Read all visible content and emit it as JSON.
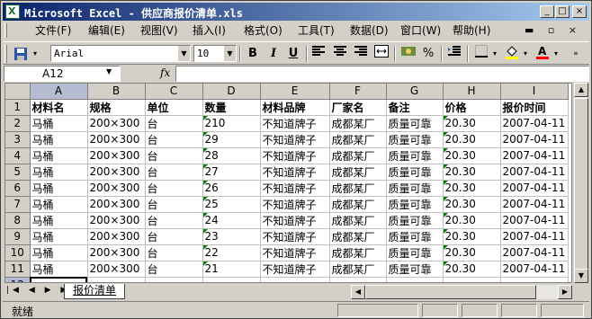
{
  "window": {
    "title": "Microsoft Excel - 供应商报价清单.xls"
  },
  "caption_buttons": [
    "_",
    "□",
    "×"
  ],
  "menu": [
    "文件(F)",
    "编辑(E)",
    "视图(V)",
    "插入(I)",
    "格式(O)",
    "工具(T)",
    "数据(D)",
    "窗口(W)",
    "帮助(H)"
  ],
  "toolbar": {
    "font_name": "Arial",
    "font_size": "10",
    "bold": "B",
    "italic": "I",
    "underline": "U",
    "percent": "%"
  },
  "formula_bar": {
    "cell_ref": "A12",
    "fx": "fx",
    "formula": ""
  },
  "grid": {
    "columns": [
      "A",
      "B",
      "C",
      "D",
      "E",
      "F",
      "G",
      "H",
      "I"
    ],
    "row_numbers": [
      "1",
      "2",
      "3",
      "4",
      "5",
      "6",
      "7",
      "8",
      "9",
      "10",
      "11",
      "12"
    ],
    "rows": [
      [
        "材料名",
        "规格",
        "单位",
        "数量",
        "材料品牌",
        "厂家名",
        "备注",
        "价格",
        "报价时间"
      ],
      [
        "马桶",
        "200×300",
        "台",
        "210",
        "不知道牌子",
        "成都某厂",
        "质量可靠",
        "20.30",
        "2007-04-11"
      ],
      [
        "马桶",
        "200×300",
        "台",
        "29",
        "不知道牌子",
        "成都某厂",
        "质量可靠",
        "20.30",
        "2007-04-11"
      ],
      [
        "马桶",
        "200×300",
        "台",
        "28",
        "不知道牌子",
        "成都某厂",
        "质量可靠",
        "20.30",
        "2007-04-11"
      ],
      [
        "马桶",
        "200×300",
        "台",
        "27",
        "不知道牌子",
        "成都某厂",
        "质量可靠",
        "20.30",
        "2007-04-11"
      ],
      [
        "马桶",
        "200×300",
        "台",
        "26",
        "不知道牌子",
        "成都某厂",
        "质量可靠",
        "20.30",
        "2007-04-11"
      ],
      [
        "马桶",
        "200×300",
        "台",
        "25",
        "不知道牌子",
        "成都某厂",
        "质量可靠",
        "20.30",
        "2007-04-11"
      ],
      [
        "马桶",
        "200×300",
        "台",
        "24",
        "不知道牌子",
        "成都某厂",
        "质量可靠",
        "20.30",
        "2007-04-11"
      ],
      [
        "马桶",
        "200×300",
        "台",
        "23",
        "不知道牌子",
        "成都某厂",
        "质量可靠",
        "20.30",
        "2007-04-11"
      ],
      [
        "马桶",
        "200×300",
        "台",
        "22",
        "不知道牌子",
        "成都某厂",
        "质量可靠",
        "20.30",
        "2007-04-11"
      ],
      [
        "马桶",
        "200×300",
        "台",
        "21",
        "不知道牌子",
        "成都某厂",
        "质量可靠",
        "20.30",
        "2007-04-11"
      ],
      [
        "",
        "",
        "",
        "",
        "",
        "",
        "",
        "",
        ""
      ]
    ],
    "active_cell": "A12"
  },
  "sheet_tabs": [
    "报价清单"
  ],
  "status": {
    "text": "就绪"
  },
  "colors": {
    "title_start": "#0a246a",
    "title_end": "#a6caf0",
    "chrome": "#d4d0c8",
    "number_flag": "#008000",
    "selected_header": "#b6bdd2"
  }
}
